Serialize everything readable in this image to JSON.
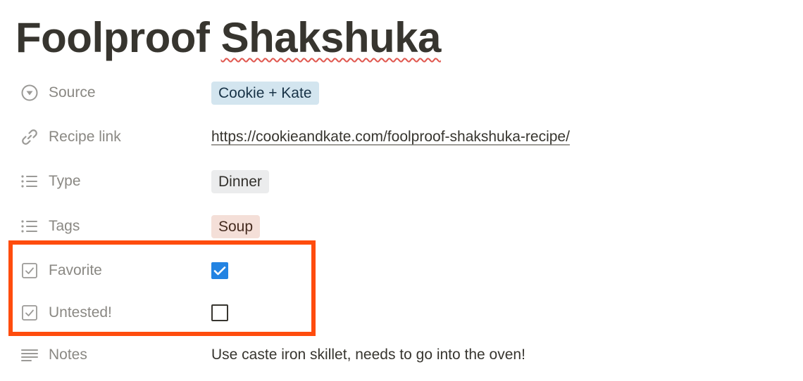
{
  "page": {
    "title_plain": "Foolproof ",
    "title_misspelled": "Shakshuka"
  },
  "properties": {
    "source": {
      "label": "Source",
      "icon": "select-icon",
      "value": "Cookie + Kate",
      "tag_color": "#d3e5ef"
    },
    "recipe_link": {
      "label": "Recipe link",
      "icon": "link-icon",
      "value": "https://cookieandkate.com/foolproof-shakshuka-recipe/"
    },
    "type": {
      "label": "Type",
      "icon": "multi-select-icon",
      "value": "Dinner",
      "tag_color": "#ebeced"
    },
    "tags": {
      "label": "Tags",
      "icon": "multi-select-icon",
      "value": "Soup",
      "tag_color": "#f4dfd8"
    },
    "favorite": {
      "label": "Favorite",
      "icon": "checkbox-property-icon",
      "checked": true
    },
    "untested": {
      "label": "Untested!",
      "icon": "checkbox-property-icon",
      "checked": false
    },
    "notes": {
      "label": "Notes",
      "icon": "text-icon",
      "value": "Use caste iron skillet, needs to go into the oven!"
    }
  },
  "colors": {
    "highlight": "#ff4c0d",
    "checkbox_checked": "#2383e2",
    "label": "#8a8883",
    "text": "#37352f"
  }
}
